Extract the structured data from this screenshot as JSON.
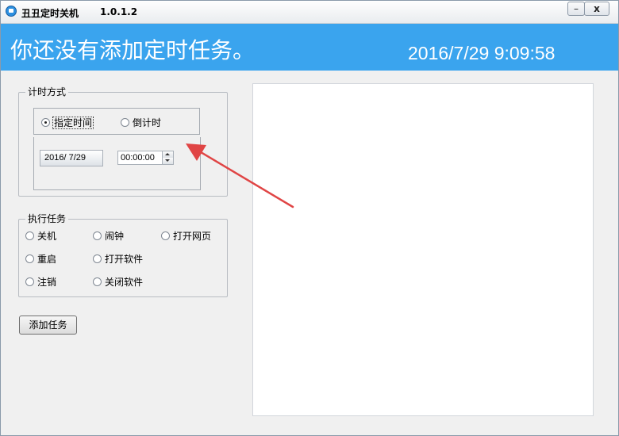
{
  "titlebar": {
    "title": "丑丑定时关机",
    "version": "1.0.1.2",
    "minimize_glyph": "–",
    "close_glyph": "x"
  },
  "banner": {
    "message": "你还没有添加定时任务。",
    "datetime": "2016/7/29 9:09:58",
    "color": "#3aa4ee"
  },
  "timing": {
    "legend": "计时方式",
    "options": [
      {
        "label": "指定时间",
        "checked": true
      },
      {
        "label": "倒计时",
        "checked": false
      }
    ],
    "date_value": "2016/ 7/29",
    "time_value": "00:00:00"
  },
  "tasks": {
    "legend": "执行任务",
    "options": [
      {
        "label": "关机"
      },
      {
        "label": "闹钟"
      },
      {
        "label": "打开网页"
      },
      {
        "label": "重启"
      },
      {
        "label": "打开软件"
      },
      {
        "label": "注销"
      },
      {
        "label": "关闭软件"
      }
    ]
  },
  "add_button_label": "添加任务",
  "annotation_arrow_color": "#e04545"
}
